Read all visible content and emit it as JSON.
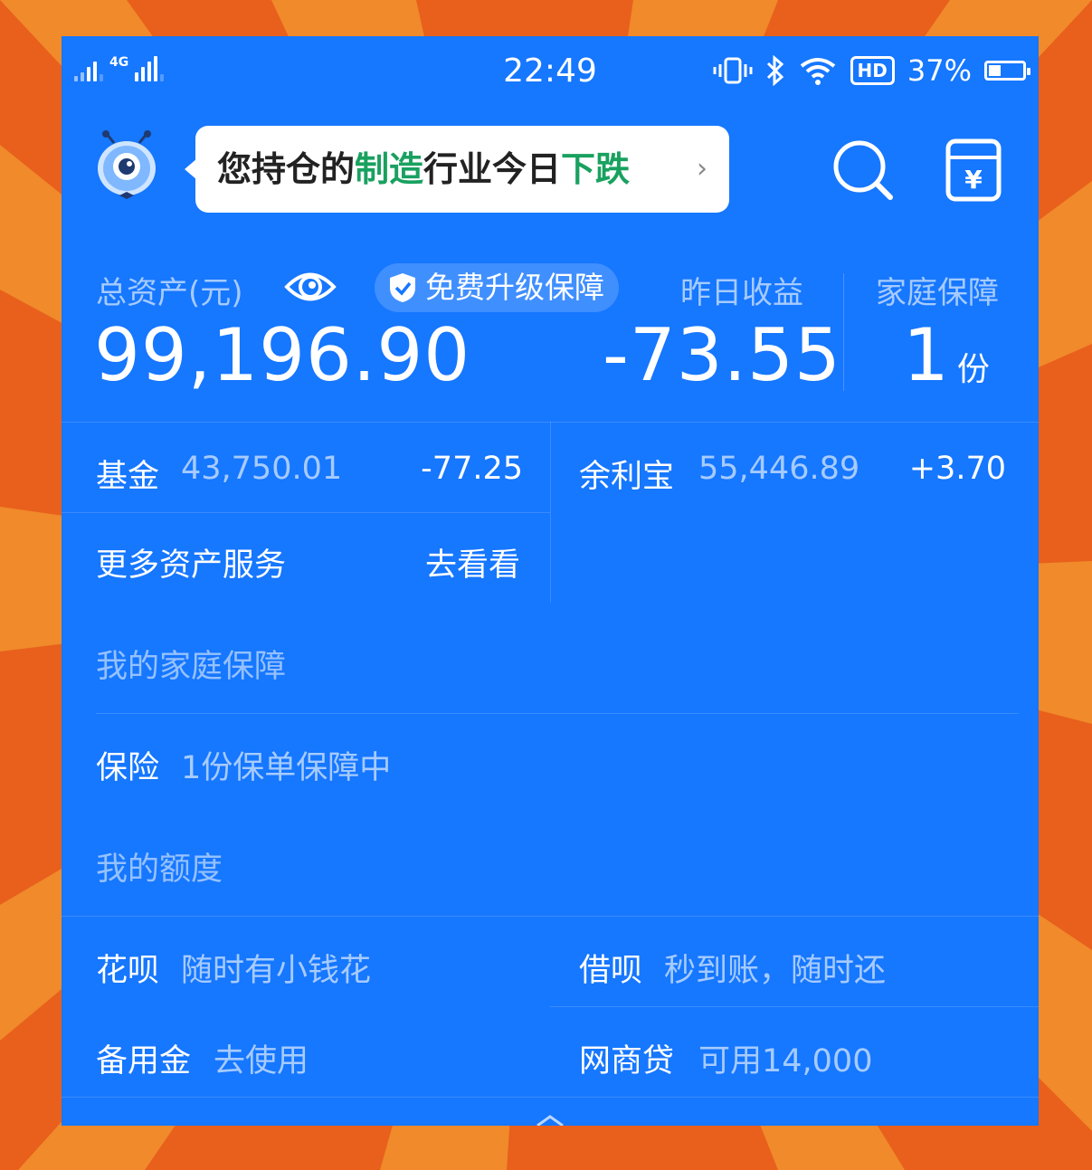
{
  "status_bar": {
    "network": "4G",
    "time": "22:49",
    "hd": "HD",
    "battery_pct": "37%",
    "battery_level": 0.37
  },
  "header": {
    "banner": {
      "p1": "您持仓的",
      "p2": "制造",
      "p3": "行业今日",
      "p4": "下跌",
      "chevron": "›"
    },
    "search_icon": "search-icon",
    "wallet_icon": "wallet-yuan-icon",
    "wallet_glyph": "¥"
  },
  "summary": {
    "total_assets_label": "总资产(元)",
    "total_assets_value": "99,196.90",
    "upgrade_label": "免费升级保障",
    "yesterday_label": "昨日收益",
    "yesterday_value": "-73.55",
    "family_label": "家庭保障",
    "family_value": "1",
    "family_unit": "份"
  },
  "holdings": [
    {
      "name": "基金",
      "amount": "43,750.01",
      "change": "-77.25"
    },
    {
      "name": "余利宝",
      "amount": "55,446.89",
      "change": "+3.70"
    }
  ],
  "more_services": {
    "label": "更多资产服务",
    "action": "去看看"
  },
  "family_protection": {
    "title": "我的家庭保障",
    "insurance_label": "保险",
    "insurance_desc": "1份保单保障中"
  },
  "credit": {
    "title": "我的额度",
    "items": [
      {
        "name": "花呗",
        "desc": "随时有小钱花"
      },
      {
        "name": "借呗",
        "desc": "秒到账，随时还"
      },
      {
        "name": "备用金",
        "desc": "去使用"
      },
      {
        "name": "网商贷",
        "desc": "可用14,000"
      }
    ]
  },
  "colors": {
    "background": "#1677ff",
    "highlight_green": "#19a15f",
    "frame_orange": "#e8601c"
  }
}
